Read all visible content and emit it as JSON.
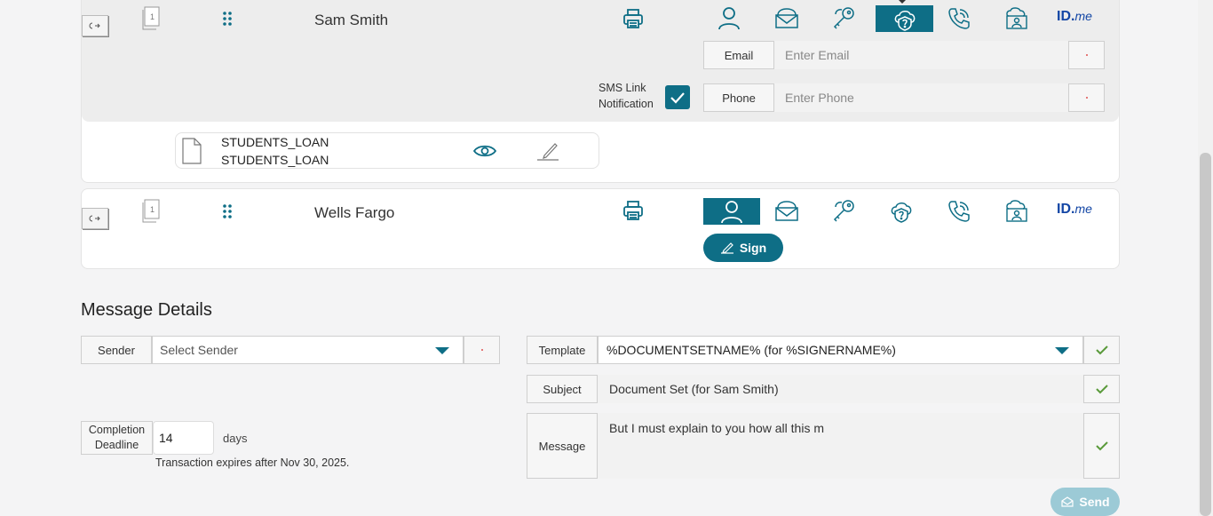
{
  "signers": [
    {
      "name": "Sam Smith",
      "page_badge": "1",
      "email_label": "Email",
      "email_placeholder": "Enter Email",
      "phone_label": "Phone",
      "phone_placeholder": "Enter Phone",
      "sms_label_line1": "SMS Link",
      "sms_label_line2": "Notification",
      "sms_checked": true,
      "active_auth": "cloud-question-icon"
    },
    {
      "name": "Wells Fargo",
      "page_badge": "1",
      "active_auth": "person-icon",
      "sign_label": "Sign"
    }
  ],
  "document": {
    "name_line1": "STUDENTS_LOAN",
    "name_line2": "STUDENTS_LOAN"
  },
  "auth_icons": [
    "person-icon",
    "envelope-icon",
    "key-icon",
    "cloud-question-icon",
    "phone-icon",
    "id-card-icon",
    "idme-icon"
  ],
  "idme_text": {
    "id": "ID.",
    "me": "me"
  },
  "message_details": {
    "title": "Message Details",
    "sender_label": "Sender",
    "sender_placeholder": "Select Sender",
    "completion_label_line1": "Completion",
    "completion_label_line2": "Deadline",
    "completion_value": "14",
    "days_label": "days",
    "expires_text": "Transaction expires after Nov 30, 2025.",
    "template_label": "Template",
    "template_value": "%DOCUMENTSETNAME% (for %SIGNERNAME%)",
    "subject_label": "Subject",
    "subject_value": "Document Set (for Sam Smith)",
    "message_label": "Message",
    "message_value": "But I must explain to you how all this m",
    "send_label": "Send"
  },
  "colors": {
    "teal": "#0e6e86",
    "green_check": "#5a9a3a",
    "send_disabled": "#9ccad6"
  }
}
